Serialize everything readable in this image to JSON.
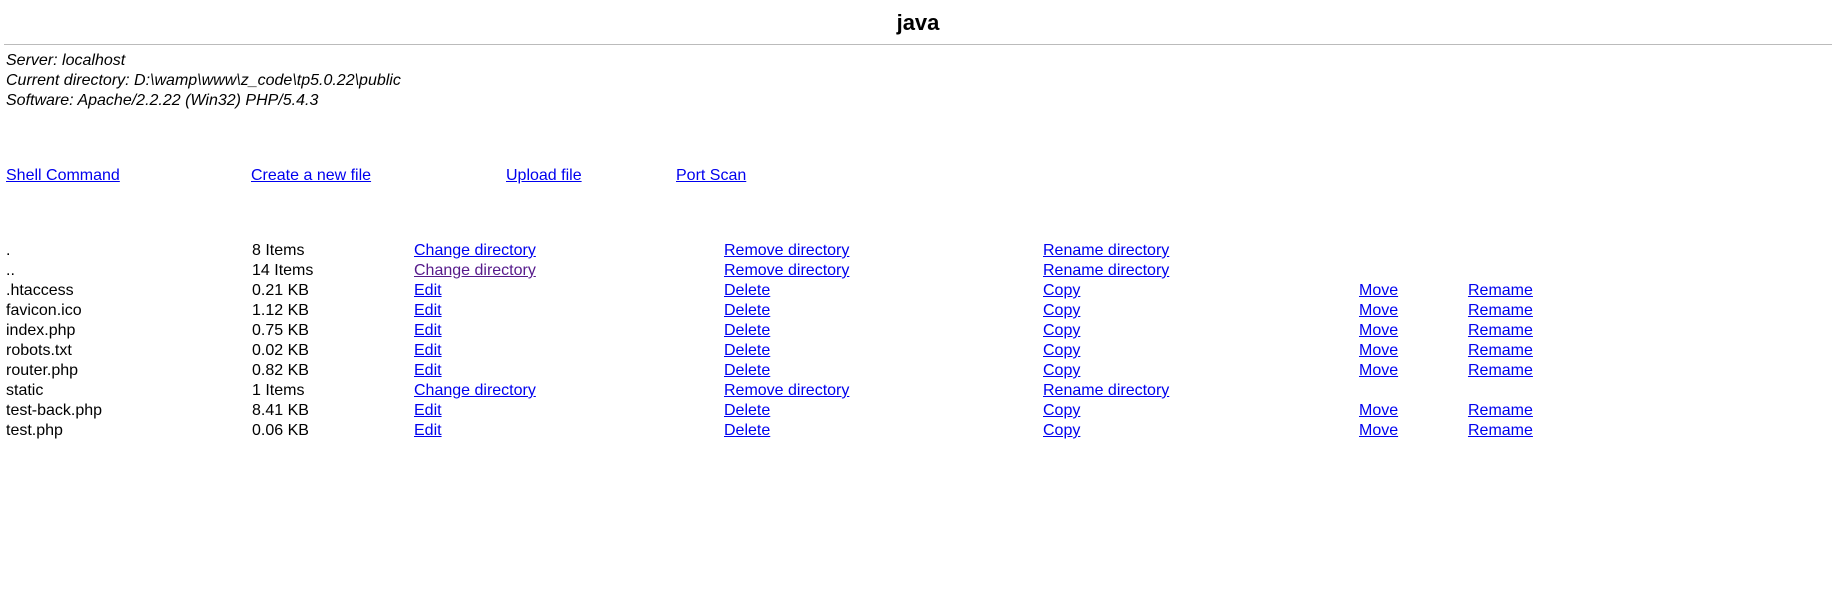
{
  "title": "java",
  "info": {
    "server_label": "Server:",
    "server_value": "localhost",
    "cwd_label": "Current directory:",
    "cwd_value": "D:\\wamp\\www\\z_code\\tp5.0.22\\public",
    "software_label": "Software:",
    "software_value": "Apache/2.2.22 (Win32) PHP/5.4.3"
  },
  "toolbar": {
    "shell_command": "Shell Command",
    "create_file": "Create a new file",
    "upload_file": "Upload file",
    "port_scan": "Port Scan"
  },
  "actions": {
    "change_dir": "Change directory",
    "remove_dir": "Remove directory",
    "rename_dir": "Rename directory",
    "edit": "Edit",
    "delete": "Delete",
    "copy": "Copy",
    "move": "Move",
    "rename_file": "Remame"
  },
  "rows": [
    {
      "type": "dir",
      "name": ".",
      "size": "8 Items",
      "visited_cd": false
    },
    {
      "type": "dir",
      "name": "..",
      "size": "14 Items",
      "visited_cd": true
    },
    {
      "type": "file",
      "name": ".htaccess",
      "size": "0.21 KB"
    },
    {
      "type": "file",
      "name": "favicon.ico",
      "size": "1.12 KB"
    },
    {
      "type": "file",
      "name": "index.php",
      "size": "0.75 KB"
    },
    {
      "type": "file",
      "name": "robots.txt",
      "size": "0.02 KB"
    },
    {
      "type": "file",
      "name": "router.php",
      "size": "0.82 KB"
    },
    {
      "type": "dir",
      "name": "static",
      "size": "1 Items",
      "visited_cd": false
    },
    {
      "type": "file",
      "name": "test-back.php",
      "size": "8.41 KB"
    },
    {
      "type": "file",
      "name": "test.php",
      "size": "0.06 KB"
    }
  ]
}
